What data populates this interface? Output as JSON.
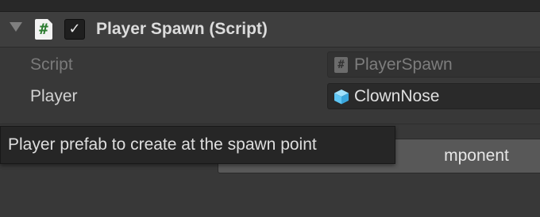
{
  "component": {
    "title": "Player Spawn (Script)",
    "enabled": true,
    "header_icon": "csharp-script-icon",
    "toggle_icon": "checkmark-icon",
    "foldout_icon": "foldout-expanded-icon"
  },
  "properties": [
    {
      "label": "Script",
      "value": "PlayerSpawn",
      "icon": "script-hash-icon",
      "disabled": true
    },
    {
      "label": "Player",
      "value": "ClownNose",
      "icon": "prefab-cube-icon",
      "disabled": false
    }
  ],
  "add_component": {
    "label": "Add Component",
    "visible_label": "mponent"
  },
  "tooltip": {
    "text": "Player prefab to create at the spawn point"
  },
  "colors": {
    "background": "#383838",
    "header": "#3e3e3e",
    "accent_cube": "#5ec6f5",
    "script_hash_green": "#2e7d32"
  }
}
